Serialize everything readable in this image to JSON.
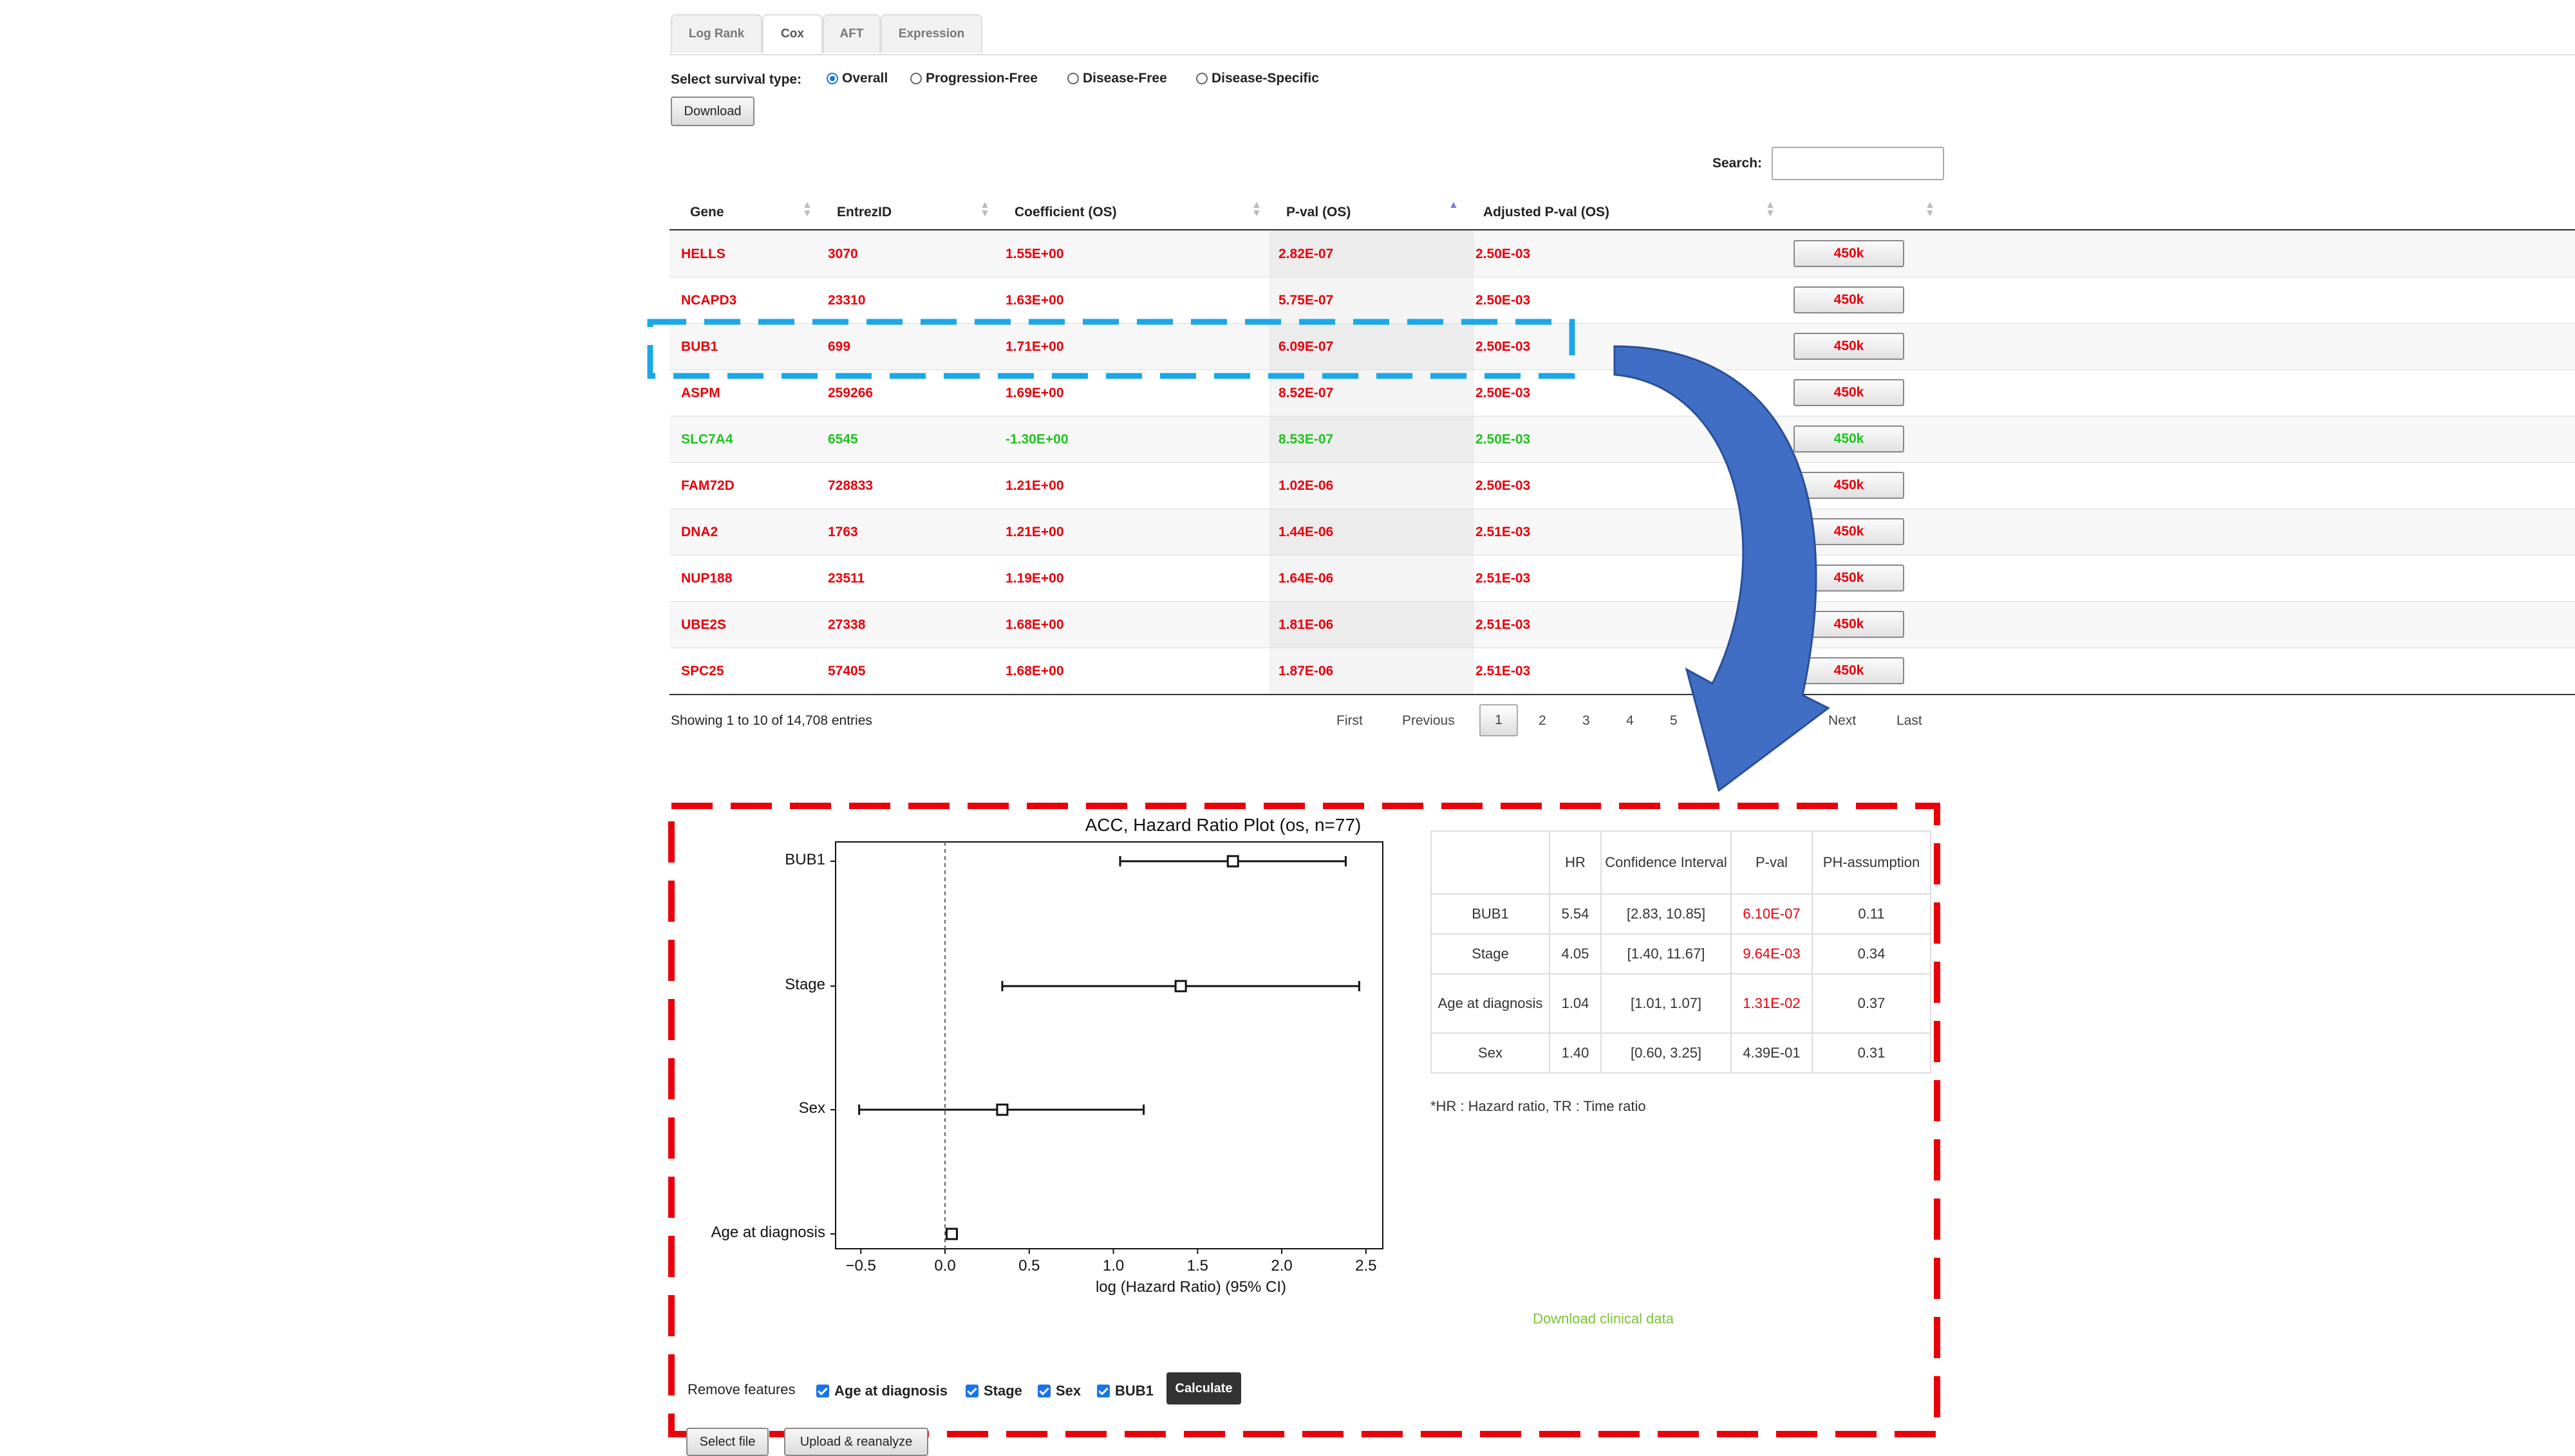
{
  "tabs": [
    "Log Rank",
    "Cox",
    "AFT",
    "Expression"
  ],
  "survival": {
    "label": "Select survival type:",
    "options": [
      "Overall",
      "Progression-Free",
      "Disease-Free",
      "Disease-Specific"
    ],
    "selected": "Overall"
  },
  "download_label": "Download",
  "search_label": "Search:",
  "table": {
    "headers": [
      "Gene",
      "EntrezID",
      "Coefficient (OS)",
      "P-val (OS)",
      "Adjusted P-val (OS)"
    ],
    "rows": [
      {
        "gene": "HELLS",
        "entrez": "3070",
        "coef": "1.55E+00",
        "pval": "2.82E-07",
        "adj": "2.50E-03",
        "btn": "450k",
        "color": "#e8000b"
      },
      {
        "gene": "NCAPD3",
        "entrez": "23310",
        "coef": "1.63E+00",
        "pval": "5.75E-07",
        "adj": "2.50E-03",
        "btn": "450k",
        "color": "#e8000b"
      },
      {
        "gene": "BUB1",
        "entrez": "699",
        "coef": "1.71E+00",
        "pval": "6.09E-07",
        "adj": "2.50E-03",
        "btn": "450k",
        "color": "#e8000b"
      },
      {
        "gene": "ASPM",
        "entrez": "259266",
        "coef": "1.69E+00",
        "pval": "8.52E-07",
        "adj": "2.50E-03",
        "btn": "450k",
        "color": "#e8000b"
      },
      {
        "gene": "SLC7A4",
        "entrez": "6545",
        "coef": "-1.30E+00",
        "pval": "8.53E-07",
        "adj": "2.50E-03",
        "btn": "450k",
        "color": "#1dc41d"
      },
      {
        "gene": "FAM72D",
        "entrez": "728833",
        "coef": "1.21E+00",
        "pval": "1.02E-06",
        "adj": "2.50E-03",
        "btn": "450k",
        "color": "#e8000b"
      },
      {
        "gene": "DNA2",
        "entrez": "1763",
        "coef": "1.21E+00",
        "pval": "1.44E-06",
        "adj": "2.51E-03",
        "btn": "450k",
        "color": "#e8000b"
      },
      {
        "gene": "NUP188",
        "entrez": "23511",
        "coef": "1.19E+00",
        "pval": "1.64E-06",
        "adj": "2.51E-03",
        "btn": "450k",
        "color": "#e8000b"
      },
      {
        "gene": "UBE2S",
        "entrez": "27338",
        "coef": "1.68E+00",
        "pval": "1.81E-06",
        "adj": "2.51E-03",
        "btn": "450k",
        "color": "#e8000b"
      },
      {
        "gene": "SPC25",
        "entrez": "57405",
        "coef": "1.68E+00",
        "pval": "1.87E-06",
        "adj": "2.51E-03",
        "btn": "450k",
        "color": "#e8000b"
      }
    ]
  },
  "showing": "Showing 1 to 10 of 14,708 entries",
  "pagination": {
    "first": "First",
    "previous": "Previous",
    "pages": [
      "1",
      "2",
      "3",
      "4",
      "5"
    ],
    "current": "1",
    "last_page": "1",
    "next": "Next",
    "last": "Last"
  },
  "chart_data": {
    "type": "scatter",
    "title": "ACC, Hazard Ratio Plot (os, n=77)",
    "xlabel": "log (Hazard Ratio) (95% CI)",
    "ylabel": "",
    "categories": [
      "BUB1",
      "Stage",
      "Sex",
      "Age at diagnosis"
    ],
    "series": [
      {
        "values": [
          1.71,
          1.4,
          0.34,
          0.04
        ],
        "ci_low": [
          1.04,
          0.34,
          -0.51,
          0.01
        ],
        "ci_high": [
          2.38,
          2.46,
          1.18,
          0.07
        ]
      }
    ],
    "xlim": [
      -0.65,
      2.6
    ],
    "xticks": [
      "−0.5",
      "0.0",
      "0.5",
      "1.0",
      "1.5",
      "2.0",
      "2.5"
    ],
    "xtick_values": [
      -0.5,
      0,
      0.5,
      1.0,
      1.5,
      2.0,
      2.5
    ],
    "reference_line": 0,
    "grid": false
  },
  "download_clinical": "Download clinical data",
  "hr_table": {
    "headers": [
      "",
      "HR",
      "Confidence Interval",
      "P-val",
      "PH-assumption"
    ],
    "rows": [
      {
        "name": "BUB1",
        "hr": "5.54",
        "ci": "[2.83, 10.85]",
        "p": "6.10E-07",
        "ph": "0.11",
        "sig": true
      },
      {
        "name": "Stage",
        "hr": "4.05",
        "ci": "[1.40, 11.67]",
        "p": "9.64E-03",
        "ph": "0.34",
        "sig": true
      },
      {
        "name": "Age at diagnosis",
        "hr": "1.04",
        "ci": "[1.01, 1.07]",
        "p": "1.31E-02",
        "ph": "0.37",
        "sig": true
      },
      {
        "name": "Sex",
        "hr": "1.40",
        "ci": "[0.60, 3.25]",
        "p": "4.39E-01",
        "ph": "0.31",
        "sig": false
      }
    ],
    "footnote": "*HR : Hazard ratio, TR : Time ratio"
  },
  "remove_features": {
    "label": "Remove features",
    "options": [
      "Age at diagnosis",
      "Stage",
      "Sex",
      "BUB1"
    ],
    "calculate": "Calculate"
  },
  "select_file": "Select file",
  "upload": "Upload & reanalyze",
  "colors": {
    "positive": "#e8000b",
    "negative": "#1dc41d",
    "highlight_cyan": "#1ba7e8",
    "highlight_red": "#e8000b",
    "arrow": "#3f6ec4",
    "link_green": "#7cc236"
  }
}
